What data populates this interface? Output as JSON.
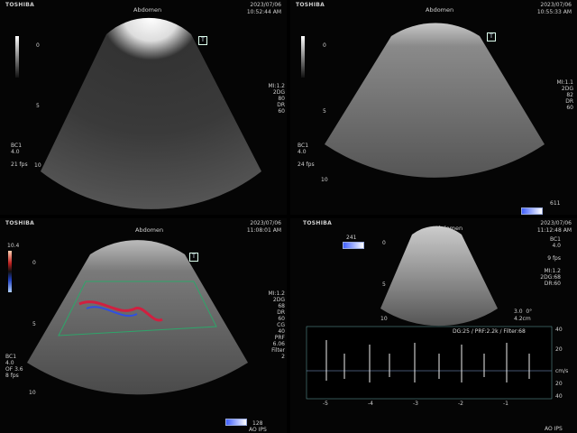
{
  "panels": [
    {
      "brand": "TOSHIBA",
      "preset": "Abdomen",
      "date": "2023/07/06",
      "time": "10:52:44 AM",
      "depth_marks": [
        "0",
        "5",
        "10"
      ],
      "params_right": "MI:1.2\n2DG\n80\nDR\n60",
      "params_left": "BC1\n4.0\n\n21 fps",
      "mode": "2D"
    },
    {
      "brand": "TOSHIBA",
      "preset": "Abdomen",
      "date": "2023/07/06",
      "time": "10:55:33 AM",
      "depth_marks": [
        "0",
        "5",
        "10"
      ],
      "params_right": "MI:1.1\n2DG\n82\nDR\n60",
      "params_left": "BC1\n4.0\n\n24 fps",
      "mode": "2D",
      "frame_counter": "611"
    },
    {
      "brand": "TOSHIBA",
      "preset": "Abdomen",
      "date": "2023/07/06",
      "time": "11:08:01 AM",
      "depth_marks": [
        "0",
        "5",
        "10"
      ],
      "scale_top": "10.4",
      "params_right": "MI:1.2\n2DG\n68\nDR\n60\nCG\n40\nPRF\n6.06\nFilter\n2",
      "params_left": "BC1\n4.0\nOF 3.6\n8 fps",
      "mode": "Color",
      "frame_counter": "128",
      "probe_label": "AO IPS"
    },
    {
      "brand": "TOSHIBA",
      "preset": "Abdomen",
      "date": "2023/07/06",
      "time": "11:12:48 AM",
      "depth_marks": [
        "0",
        "5",
        "10"
      ],
      "params_right": "BC1\n4.0\n\n9 fps\n\nMI:1.2\n2DG:68\nDR:60",
      "frame_counter": "241",
      "mode": "PW Doppler",
      "doppler_info": "DG:25 / PRF:2.2k / Filter:68",
      "angle": "3.0  0°",
      "depth_cm": "4.2cm",
      "doppler_y_labels": [
        "40",
        "20",
        "cm/s",
        "20",
        "40"
      ],
      "doppler_x_labels": [
        "-5",
        "-4",
        "-3",
        "-2",
        "-1"
      ],
      "probe_label": "AO IPS"
    }
  ]
}
